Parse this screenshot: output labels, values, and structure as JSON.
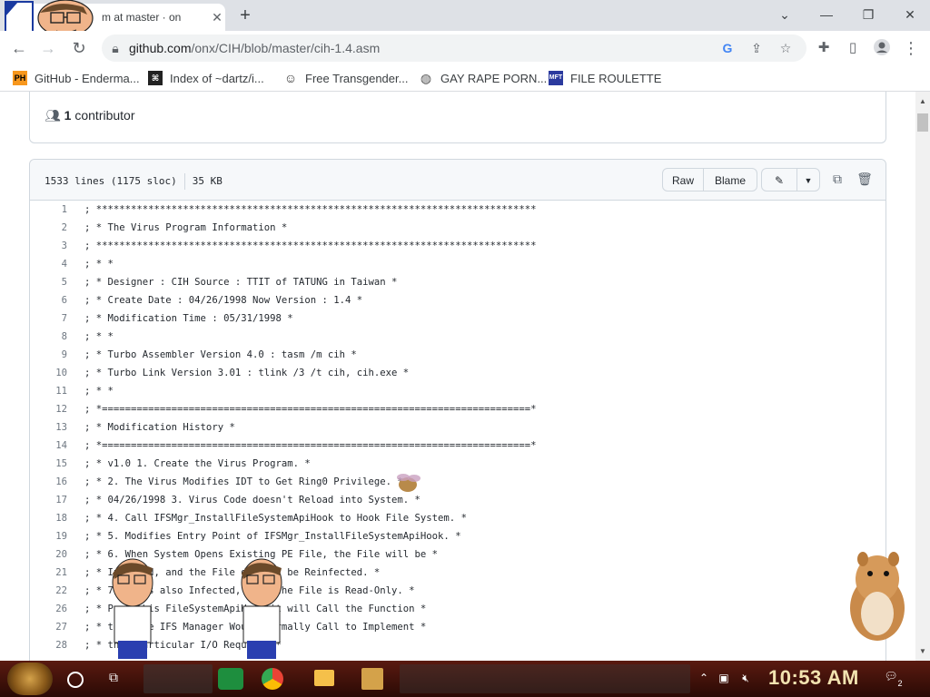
{
  "browser": {
    "tab_title": "m at master · on",
    "url_host": "github.com",
    "url_path": "/onx/CIH/blob/master/cih-1.4.asm",
    "icons": {
      "new_tab": "plus-icon",
      "close_tab": "close-icon",
      "minimize": "chevron-down-icon",
      "search_tabs": "minimize-icon",
      "maximize": "restore-icon",
      "close_window": "close-icon",
      "back": "back-arrow-icon",
      "forward": "forward-arrow-icon",
      "reload": "reload-icon",
      "lock": "lock-icon",
      "google": "google-icon",
      "share": "share-icon",
      "star": "star-icon",
      "extensions": "puzzle-icon",
      "sidepanel": "sidepanel-icon",
      "profile": "profile-icon",
      "menu": "more-vert-icon"
    }
  },
  "bookmarks": [
    {
      "label": "GitHub - Enderma...",
      "icon": "PH"
    },
    {
      "label": "Index of ~dartz/i...",
      "icon": "index-icon"
    },
    {
      "label": "Free Transgender...",
      "icon": "mask-icon"
    },
    {
      "label": "GAY RAPE PORN...",
      "icon": "globe-icon"
    },
    {
      "label": "FILE ROULETTE",
      "icon": "file-roulette-icon"
    }
  ],
  "contributors": {
    "count": "1",
    "label": "contributor"
  },
  "file": {
    "lines_info": "1533 lines (1175 sloc)",
    "size": "35 KB",
    "raw": "Raw",
    "blame": "Blame"
  },
  "code_lines": [
    {
      "n": "1",
      "t": "; ****************************************************************************"
    },
    {
      "n": "2",
      "t": "; * The Virus Program Information *"
    },
    {
      "n": "3",
      "t": "; ****************************************************************************"
    },
    {
      "n": "4",
      "t": "; * *"
    },
    {
      "n": "5",
      "t": "; * Designer : CIH Source : TTIT of TATUNG in Taiwan *"
    },
    {
      "n": "6",
      "t": "; * Create Date : 04/26/1998 Now Version : 1.4 *"
    },
    {
      "n": "7",
      "t": "; * Modification Time : 05/31/1998 *"
    },
    {
      "n": "8",
      "t": "; * *"
    },
    {
      "n": "9",
      "t": "; * Turbo Assembler Version 4.0 : tasm /m cih *"
    },
    {
      "n": "10",
      "t": "; * Turbo Link Version 3.01 : tlink /3 /t cih, cih.exe *"
    },
    {
      "n": "11",
      "t": "; * *"
    },
    {
      "n": "12",
      "t": "; *==========================================================================*"
    },
    {
      "n": "13",
      "t": "; * Modification History *"
    },
    {
      "n": "14",
      "t": "; *==========================================================================*"
    },
    {
      "n": "15",
      "t": "; * v1.0 1. Create the Virus Program. *"
    },
    {
      "n": "16",
      "t": "; * 2. The Virus Modifies IDT to Get Ring0 Privilege. *"
    },
    {
      "n": "17",
      "t": "; * 04/26/1998 3. Virus Code doesn't Reload into System. *"
    },
    {
      "n": "18",
      "t": "; * 4. Call IFSMgr_InstallFileSystemApiHook to Hook File System. *"
    },
    {
      "n": "19",
      "t": "; * 5. Modifies Entry Point of IFSMgr_InstallFileSystemApiHook. *"
    },
    {
      "n": "20",
      "t": "; * 6. When System Opens Existing PE File, the File will be *"
    },
    {
      "n": "21",
      "t": "; * Infected, and the File doesn't be Reinfected. *"
    },
    {
      "n": "22",
      "t": "; * 7. It is also Infected, even the File is Read-Only. *"
    },
    {
      "n": "26",
      "t": "; * Pass this FileSystemApiHook it will Call the Function *"
    },
    {
      "n": "27",
      "t": "; * that the IFS Manager Would Normally Call to Implement *"
    },
    {
      "n": "28",
      "t": "; * this Particular I/O Request. *"
    }
  ],
  "taskbar": {
    "time": "10:53 AM",
    "notification_count": "2"
  }
}
